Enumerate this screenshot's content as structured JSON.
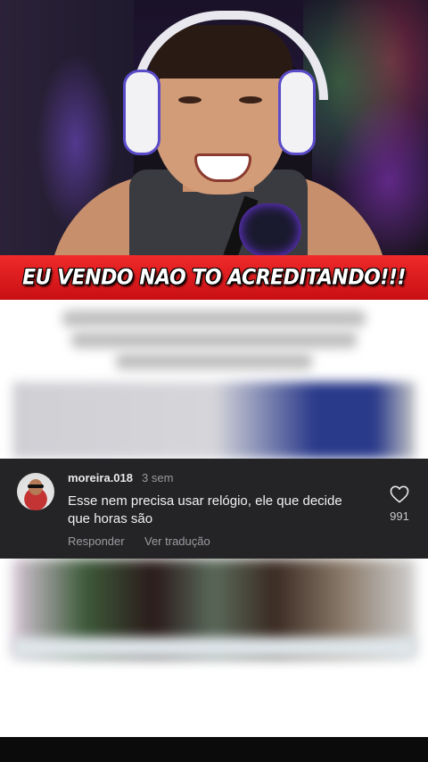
{
  "banner": {
    "text": "EU VENDO NAO TO ACREDITANDO!!!"
  },
  "comment": {
    "username": "moreira.018",
    "time": "3 sem",
    "text": "Esse nem precisa usar relógio, ele que decide que horas são",
    "reply_label": "Responder",
    "translate_label": "Ver tradução",
    "like_count": "991",
    "like_icon": "heart-outline-icon"
  },
  "colors": {
    "banner": "#e01e22",
    "comment_bg": "#242427",
    "post_bg": "#ffffff"
  }
}
